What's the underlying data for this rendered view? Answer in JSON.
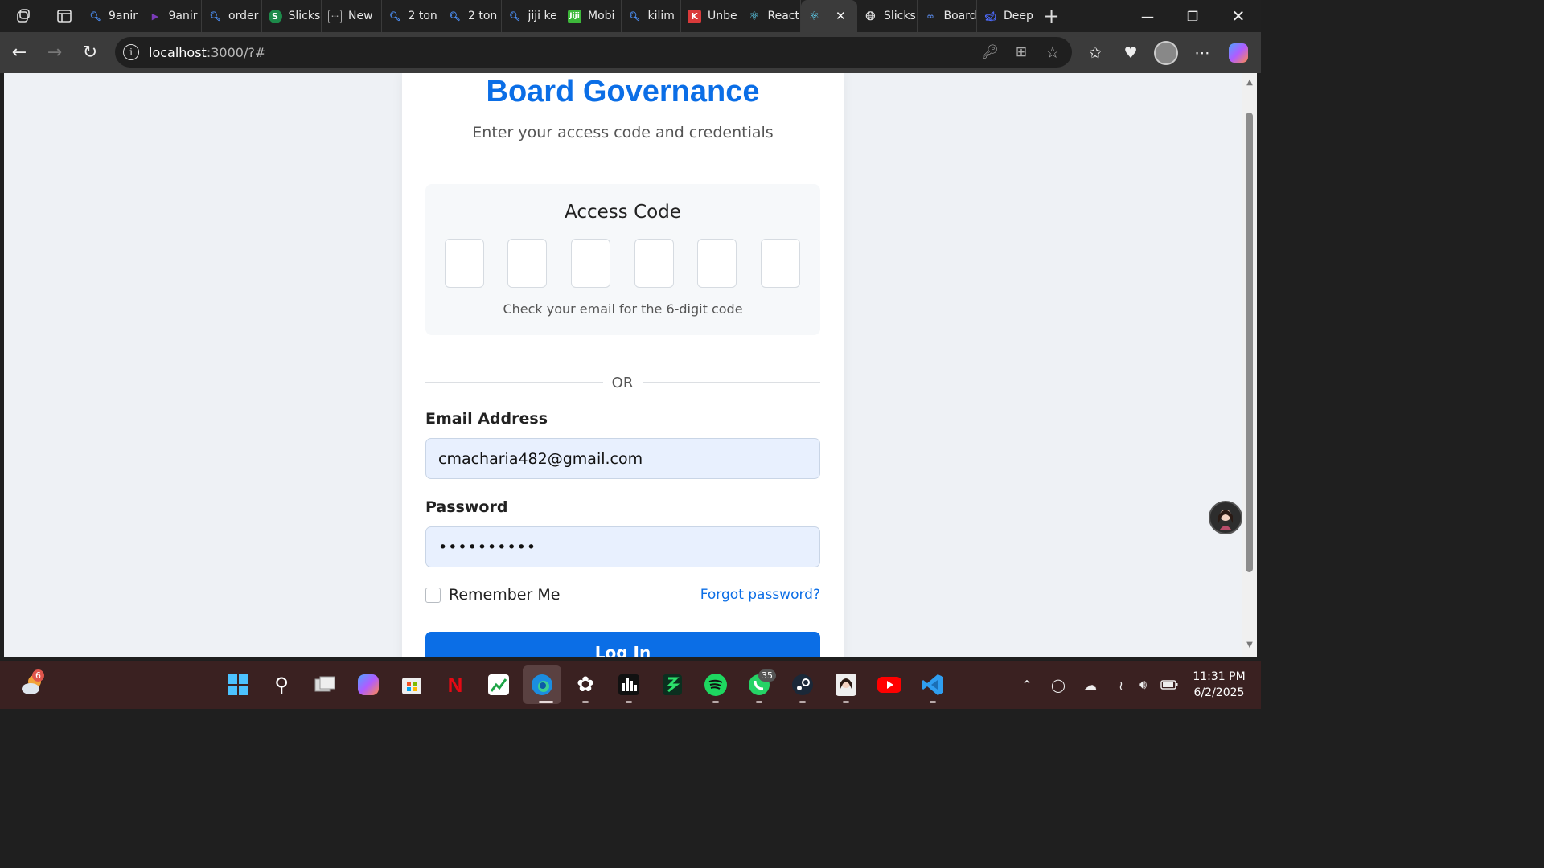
{
  "browser": {
    "tabs": [
      {
        "title": "9anir",
        "icon": "search-icon"
      },
      {
        "title": "9anir",
        "icon": "play-icon"
      },
      {
        "title": "order",
        "icon": "search-icon"
      },
      {
        "title": "Slicks",
        "icon": "slick-icon"
      },
      {
        "title": "New",
        "icon": "newtab-icon"
      },
      {
        "title": "2 ton",
        "icon": "search-icon"
      },
      {
        "title": "2 ton",
        "icon": "search-icon"
      },
      {
        "title": "jiji ke",
        "icon": "search-icon"
      },
      {
        "title": "Mobi",
        "icon": "jiji-icon"
      },
      {
        "title": "kilim",
        "icon": "search-icon"
      },
      {
        "title": "Unbe",
        "icon": "k-icon"
      },
      {
        "title": "React",
        "icon": "react-icon"
      },
      {
        "title": "",
        "icon": "react-icon",
        "active": true
      },
      {
        "title": "Slicks",
        "icon": "globe-icon"
      },
      {
        "title": "Board",
        "icon": "link-icon"
      },
      {
        "title": "Deep",
        "icon": "whale-icon"
      }
    ],
    "url_host": "localhost",
    "url_rest": ":3000/?#"
  },
  "login": {
    "title": "Board Governance",
    "subtitle": "Enter your access code and credentials",
    "code_title": "Access Code",
    "code_hint": "Check your email for the 6-digit code",
    "or_text": "OR",
    "email_label": "Email Address",
    "email_value": "cmacharia482@gmail.com",
    "password_label": "Password",
    "password_value": "••••••••••",
    "remember_label": "Remember Me",
    "forgot_label": "Forgot password?",
    "login_label": "Log In"
  },
  "taskbar": {
    "weather_badge": "6",
    "whatsapp_badge": "35",
    "time": "11:31 PM",
    "date": "6/2/2025"
  },
  "colors": {
    "accent": "#0b6ee6",
    "field_bg": "#e8f0fe"
  }
}
